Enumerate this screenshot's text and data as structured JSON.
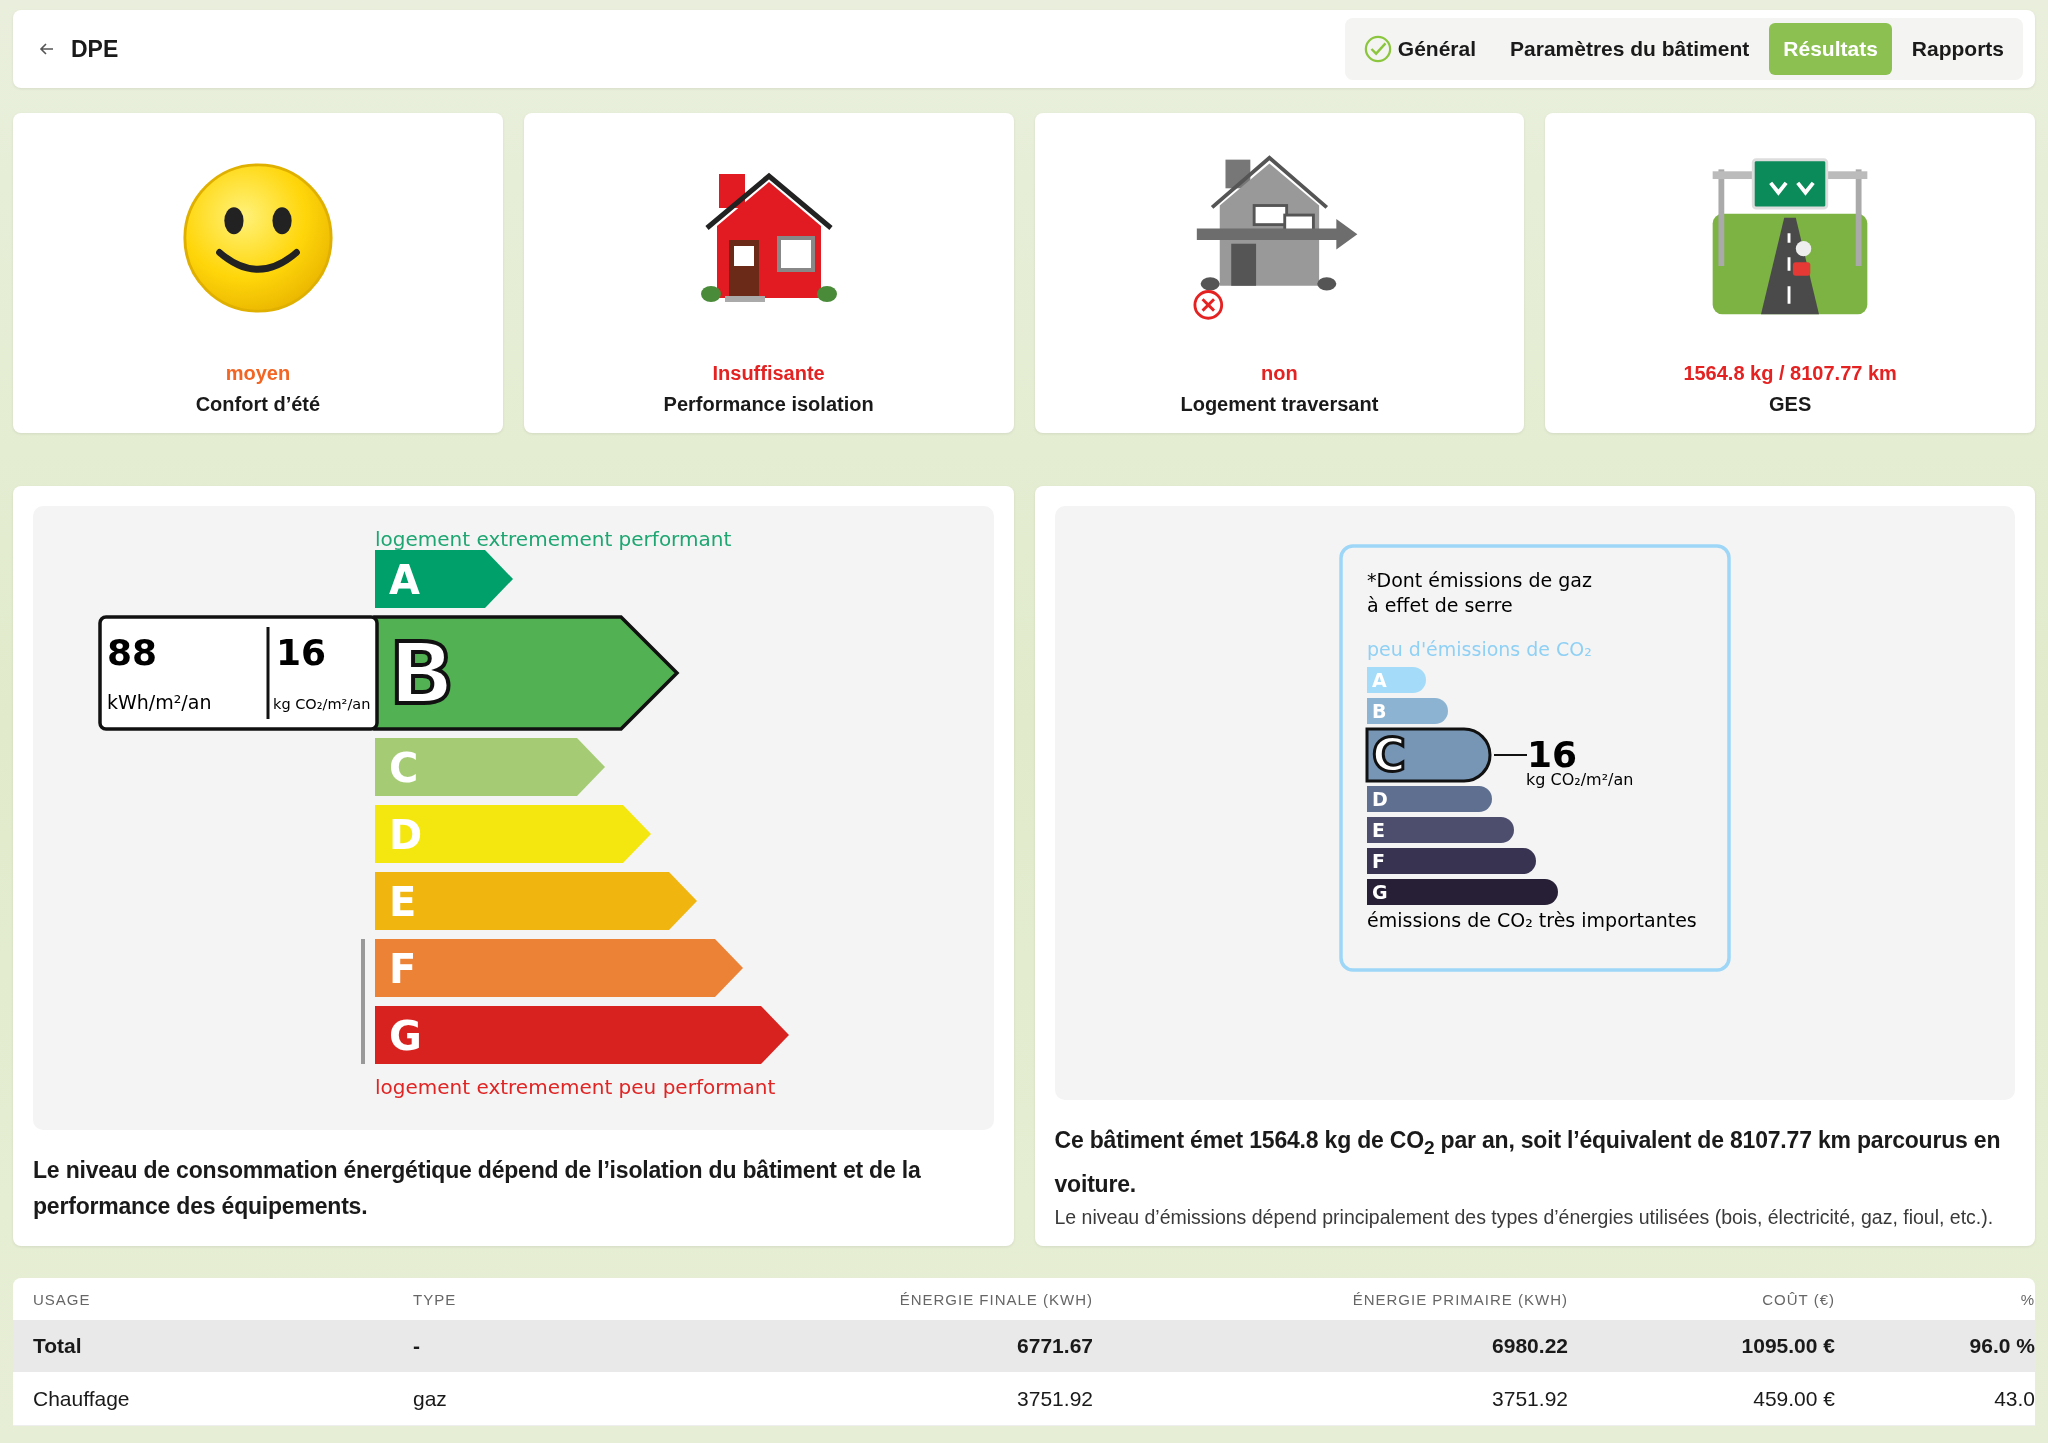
{
  "header": {
    "title": "DPE",
    "tabs": [
      {
        "label": "Général",
        "selected": false,
        "completed": true
      },
      {
        "label": "Paramètres du bâtiment",
        "selected": false,
        "completed": false
      },
      {
        "label": "Résultats",
        "selected": true,
        "completed": false
      },
      {
        "label": "Rapports",
        "selected": false,
        "completed": false
      }
    ]
  },
  "indicators": [
    {
      "kind": "smiley",
      "status": "moyen",
      "color": "#f26522",
      "label": "Confort d’été"
    },
    {
      "kind": "house",
      "status": "Insuffisante",
      "color": "#e42222",
      "label": "Performance isolation"
    },
    {
      "kind": "through-house",
      "status": "non",
      "color": "#e42222",
      "label": "Logement traversant"
    },
    {
      "kind": "road",
      "status": "1564.8 kg / 8107.77 km",
      "color": "#e42222",
      "label": "GES"
    }
  ],
  "energy_label": {
    "top_text": "logement extremement performant",
    "bottom_text": "logement extremement peu performant",
    "energy_value": "88",
    "energy_unit": "kWh/m²/an",
    "emission_value": "16",
    "emission_unit": "kg CO₂/m²/an",
    "classes": [
      {
        "letter": "A",
        "color": "#00a06b",
        "selected": false
      },
      {
        "letter": "B",
        "color": "#52b153",
        "selected": true
      },
      {
        "letter": "C",
        "color": "#a5cc74",
        "selected": false
      },
      {
        "letter": "D",
        "color": "#f4e70f",
        "selected": false
      },
      {
        "letter": "E",
        "color": "#f0b50f",
        "selected": false
      },
      {
        "letter": "F",
        "color": "#eb8235",
        "selected": false
      },
      {
        "letter": "G",
        "color": "#d7221f",
        "selected": false
      }
    ],
    "caption": "Le niveau de consommation énergétique dépend de l’isolation du bâtiment et de la performance des équipements."
  },
  "emission_label": {
    "title_lines": [
      "*Dont émissions de gaz",
      "à effet de serre"
    ],
    "top_text": "peu d'émissions de CO₂",
    "bottom_text": "émissions de CO₂ très importantes",
    "value": "16",
    "unit": "kg CO₂/m²/an",
    "classes": [
      {
        "letter": "A",
        "color": "#a4dbf8",
        "selected": false
      },
      {
        "letter": "B",
        "color": "#8cb4d2",
        "selected": false
      },
      {
        "letter": "C",
        "color": "#7795b4",
        "selected": true
      },
      {
        "letter": "D",
        "color": "#5f6f8f",
        "selected": false
      },
      {
        "letter": "E",
        "color": "#4d4e6e",
        "selected": false
      },
      {
        "letter": "F",
        "color": "#383350",
        "selected": false
      },
      {
        "letter": "G",
        "color": "#271f35",
        "selected": false
      }
    ],
    "caption": "Ce bâtiment émet 1564.8 kg de CO$_{2}$ par an, soit l’équivalent de 8107.77 km parcourus en voiture.",
    "note": "Le niveau d’émissions dépend principalement des types d’énergies utilisées (bois, électricité, gaz, fioul, etc.)."
  },
  "table": {
    "columns": [
      "USAGE",
      "TYPE",
      "ÉNERGIE FINALE (KWH)",
      "ÉNERGIE PRIMAIRE (KWH)",
      "COÛT (€)",
      "%"
    ],
    "rows": [
      {
        "kind": "total",
        "cells": [
          "Total",
          "-",
          "6771.67",
          "6980.22",
          "1095.00 €",
          "96.0 %"
        ]
      },
      {
        "kind": "item",
        "cells": [
          "Chauffage",
          "gaz",
          "3751.92",
          "3751.92",
          "459.00 €",
          "43.0"
        ]
      }
    ]
  }
}
